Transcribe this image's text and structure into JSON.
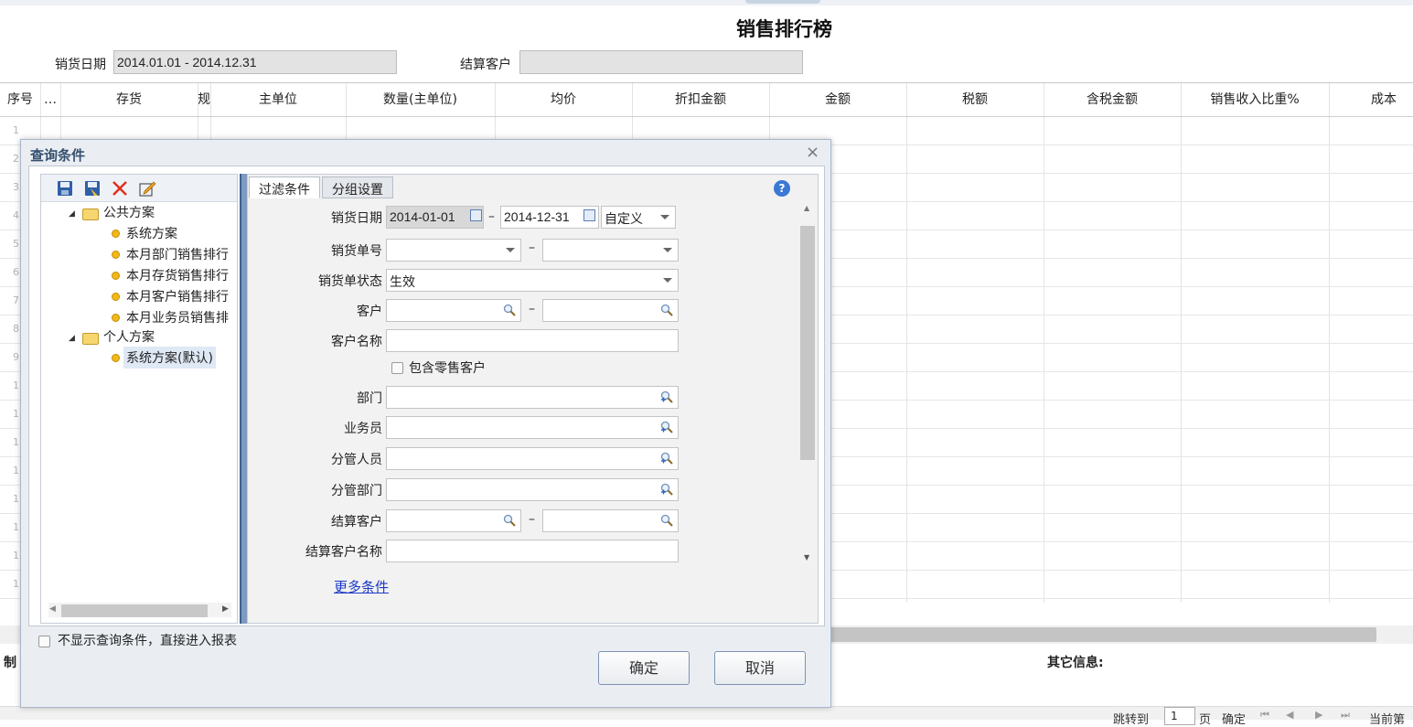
{
  "report": {
    "title": "销售排行榜",
    "date_label": "销货日期",
    "date_value": "2014.01.01 - 2014.12.31",
    "customer_label": "结算客户",
    "customer_value": ""
  },
  "grid": {
    "columns": [
      "序号",
      "…",
      "存货",
      "规",
      "主单位",
      "数量(主单位)",
      "均价",
      "折扣金额",
      "金额",
      "税额",
      "含税金额",
      "销售收入比重%",
      "成本"
    ],
    "row_numbers": [
      "1",
      "2",
      "3",
      "4",
      "5",
      "6",
      "7",
      "8",
      "9",
      "1",
      "1",
      "1",
      "1",
      "1",
      "1",
      "1",
      "1"
    ]
  },
  "footer": {
    "maker_label": "制",
    "other_info_label": "其它信息:",
    "pager_jump": "跳转到",
    "pager_page_value": "1",
    "pager_page_unit": "页",
    "pager_ok": "确定",
    "pager_current": "当前第"
  },
  "dialog": {
    "title": "查询条件",
    "close_glyph": "×",
    "toolbar_icons": [
      "save-icon",
      "save-as-icon",
      "delete-icon",
      "edit-icon"
    ],
    "tree": {
      "public_group": "公共方案",
      "public_items": [
        "系统方案",
        "本月部门销售排行",
        "本月存货销售排行",
        "本月客户销售排行",
        "本月业务员销售排"
      ],
      "personal_group": "个人方案",
      "personal_items": [
        "系统方案(默认)"
      ]
    },
    "tabs": [
      "过滤条件",
      "分组设置"
    ],
    "active_tab": "过滤条件",
    "help_glyph": "?",
    "filters": {
      "sales_date_label": "销货日期",
      "sales_date_from": "2014-01-01",
      "sales_date_to": "2014-12-31",
      "sales_date_mode": "自定义",
      "order_no_label": "销货单号",
      "order_status_label": "销货单状态",
      "order_status_value": "生效",
      "customer_label": "客户",
      "customer_name_label": "客户名称",
      "include_retail_label": "包含零售客户",
      "department_label": "部门",
      "salesman_label": "业务员",
      "manager_label": "分管人员",
      "manager_dept_label": "分管部门",
      "settle_customer_label": "结算客户",
      "settle_customer_name_label": "结算客户名称",
      "range_dash": "–",
      "more_conditions": "更多条件"
    },
    "skip_dialog_label": "不显示查询条件，直接进入报表",
    "ok_button": "确定",
    "cancel_button": "取消"
  }
}
